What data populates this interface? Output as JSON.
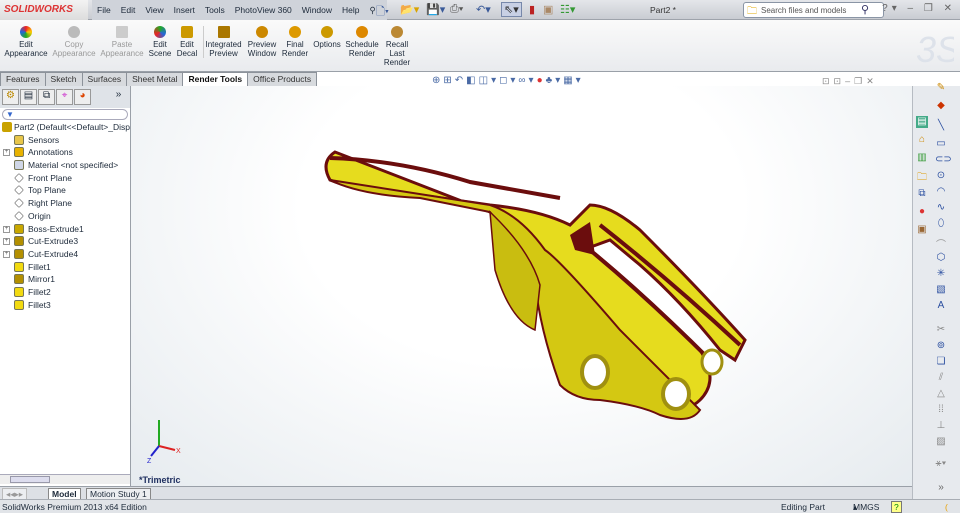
{
  "app": {
    "logo": "SOLIDWORKS",
    "doc_title": "Part2 *"
  },
  "menu": [
    "File",
    "Edit",
    "View",
    "Insert",
    "Tools",
    "PhotoView 360",
    "Window",
    "Help"
  ],
  "search": {
    "placeholder": "Search files and models"
  },
  "ribbon": [
    {
      "label": "Edit Appearance",
      "enabled": true
    },
    {
      "label": "Copy Appearance",
      "enabled": false
    },
    {
      "label": "Paste Appearance",
      "enabled": false
    },
    {
      "label": "Edit Scene",
      "enabled": true
    },
    {
      "label": "Edit Decal",
      "enabled": true
    },
    {
      "label": "Integrated Preview",
      "enabled": true
    },
    {
      "label": "Preview Window",
      "enabled": true
    },
    {
      "label": "Final Render",
      "enabled": true
    },
    {
      "label": "Options",
      "enabled": true
    },
    {
      "label": "Schedule Render",
      "enabled": true
    },
    {
      "label": "Recall Last Render",
      "enabled": true
    }
  ],
  "tabs": [
    "Features",
    "Sketch",
    "Surfaces",
    "Sheet Metal",
    "Render Tools",
    "Office Products"
  ],
  "active_tab": "Render Tools",
  "tree": {
    "root": "Part2  (Default<<Default>_Disp",
    "items": [
      {
        "label": "Sensors",
        "icon": "sensor-icon",
        "expandable": false
      },
      {
        "label": "Annotations",
        "icon": "annotation-icon",
        "expandable": true
      },
      {
        "label": "Material <not specified>",
        "icon": "material-icon",
        "expandable": false
      },
      {
        "label": "Front Plane",
        "icon": "plane-icon",
        "expandable": false
      },
      {
        "label": "Top Plane",
        "icon": "plane-icon",
        "expandable": false
      },
      {
        "label": "Right Plane",
        "icon": "plane-icon",
        "expandable": false
      },
      {
        "label": "Origin",
        "icon": "origin-icon",
        "expandable": false
      },
      {
        "label": "Boss-Extrude1",
        "icon": "extrude-icon",
        "expandable": true
      },
      {
        "label": "Cut-Extrude3",
        "icon": "cut-icon",
        "expandable": true
      },
      {
        "label": "Cut-Extrude4",
        "icon": "cut-icon",
        "expandable": true
      },
      {
        "label": "Fillet1",
        "icon": "fillet-icon",
        "expandable": false
      },
      {
        "label": "Mirror1",
        "icon": "mirror-icon",
        "expandable": false
      },
      {
        "label": "Fillet2",
        "icon": "fillet-icon",
        "expandable": false
      },
      {
        "label": "Fillet3",
        "icon": "fillet-icon",
        "expandable": false
      }
    ]
  },
  "viewport": {
    "view_label": "*Trimetric",
    "axis_x": "X",
    "axis_z": "Z"
  },
  "bottom_tabs": [
    "Model",
    "Motion Study 1"
  ],
  "status": {
    "edition": "SolidWorks Premium 2013 x64 Edition",
    "mode": "Editing Part",
    "units": "MMGS"
  },
  "colors": {
    "model_face": "#e6dc1e",
    "model_edge": "#6b0d0d"
  }
}
